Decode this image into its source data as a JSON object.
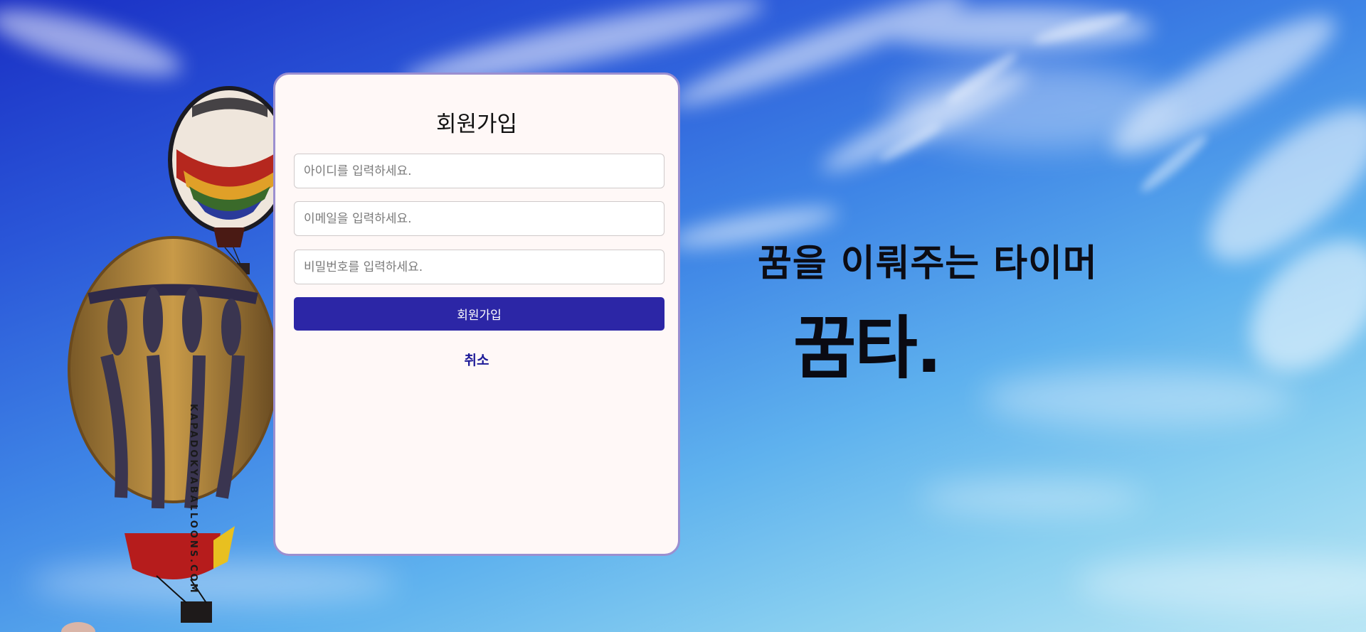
{
  "signup_form": {
    "title": "회원가입",
    "id_placeholder": "아이디를 입력하세요.",
    "email_placeholder": "이메일을 입력하세요.",
    "password_placeholder": "비밀번호를 입력하세요.",
    "submit_label": "회원가입",
    "cancel_label": "취소"
  },
  "hero": {
    "tagline": "꿈을 이뤄주는 타이머",
    "brand": "꿈타."
  },
  "colors": {
    "accent": "#2c26a6",
    "cancel_text": "#1d1a98",
    "card_background": "#fff8f7",
    "card_border": "#9b8fd0"
  },
  "background": {
    "subject": "hot-air-balloons-in-blue-sky",
    "balloon_text": "KAPADOKYABALLOONS.COM"
  }
}
